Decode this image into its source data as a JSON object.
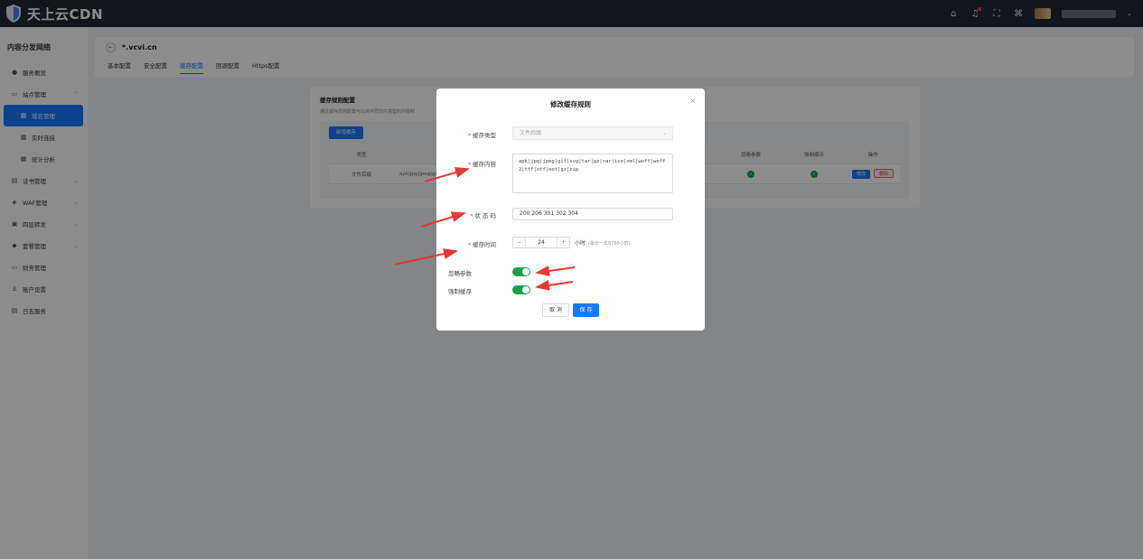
{
  "app": {
    "brand": "天上云CDN"
  },
  "topbar": {
    "icons": [
      "home-icon",
      "bell-icon",
      "fullscreen-icon",
      "translate-icon"
    ]
  },
  "sidebar": {
    "title": "内容分发网络",
    "items": [
      {
        "label": "服务概览",
        "icon": "dashboard-icon"
      },
      {
        "label": "站点管理",
        "icon": "site-icon"
      },
      {
        "label": "域名管理",
        "icon": "grid-icon"
      },
      {
        "label": "实时连接",
        "icon": "grid-icon"
      },
      {
        "label": "统计分析",
        "icon": "grid-icon"
      },
      {
        "label": "证书管理",
        "icon": "certificate-icon"
      },
      {
        "label": "WAF管理",
        "icon": "shield-icon"
      },
      {
        "label": "四层转发",
        "icon": "forward-icon"
      },
      {
        "label": "套餐管理",
        "icon": "package-icon"
      },
      {
        "label": "财务管理",
        "icon": "wallet-icon"
      },
      {
        "label": "账户设置",
        "icon": "user-icon"
      },
      {
        "label": "日志服务",
        "icon": "log-icon"
      }
    ]
  },
  "header": {
    "domain": "*.vcvi.cn",
    "tabs": [
      "基本配置",
      "安全配置",
      "缓存配置",
      "回源配置",
      "Https配置"
    ],
    "active_tab": 2
  },
  "cache_card": {
    "title": "缓存规则配置",
    "desc": "通过缓存规则配置可以对不同文件类型的内容制",
    "add_button": "新增缓存",
    "columns": [
      "类型",
      "",
      "忽略参数",
      "强制缓存",
      "操作"
    ],
    "row": {
      "type": "文件后缀",
      "content": "apk|jpg|jpeg|gif|s",
      "edit": "修改",
      "delete": "删除"
    }
  },
  "modal": {
    "title": "修改缓存规则",
    "close": "×",
    "cache_type_label": "缓存类型",
    "cache_type_value": "文件后缀",
    "cache_content_label": "缓存内容",
    "cache_content_value": "apk|jpg|jpeg|gif|svg|tar|gz|rar|ico|xml|woff|woff2|ttf|otf|eot|gz|zip",
    "status_label": "状 态 码",
    "status_value": "200 206 301 302 304",
    "cache_time_label": "缓存时间",
    "cache_time_value": "24",
    "cache_time_unit": "小时",
    "cache_time_hint": "(最长一年8760小时)",
    "ignore_params_label": "忽略参数",
    "force_cache_label": "强制缓存",
    "cancel": "取 消",
    "save": "保 存"
  },
  "colors": {
    "accent": "#1677ff",
    "toggle_on": "#16a34a",
    "arrow": "#e53935",
    "topbar": "#1f2937"
  }
}
